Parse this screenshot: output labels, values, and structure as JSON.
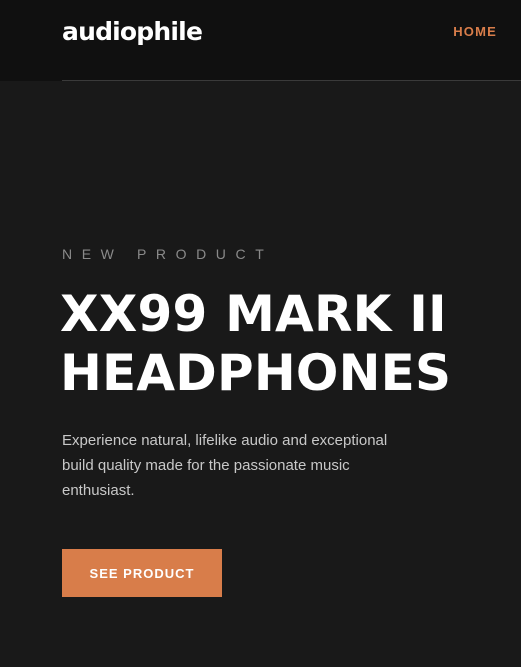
{
  "header": {
    "logo": "audiophile",
    "nav": {
      "home_label": "HOME"
    }
  },
  "hero": {
    "eyebrow": "NEW PRODUCT",
    "headline_line1": "XX99 MARK II",
    "headline_line2": "HEADPHONES",
    "description": "Experience natural, lifelike audio and exceptional build quality made for the passionate music enthusiast.",
    "cta_label": "SEE PRODUCT"
  },
  "colors": {
    "accent": "#d87d4a",
    "header_background": "#101010",
    "hero_background": "#191919",
    "text_primary": "#ffffff",
    "text_muted": "#8a8a8a"
  }
}
